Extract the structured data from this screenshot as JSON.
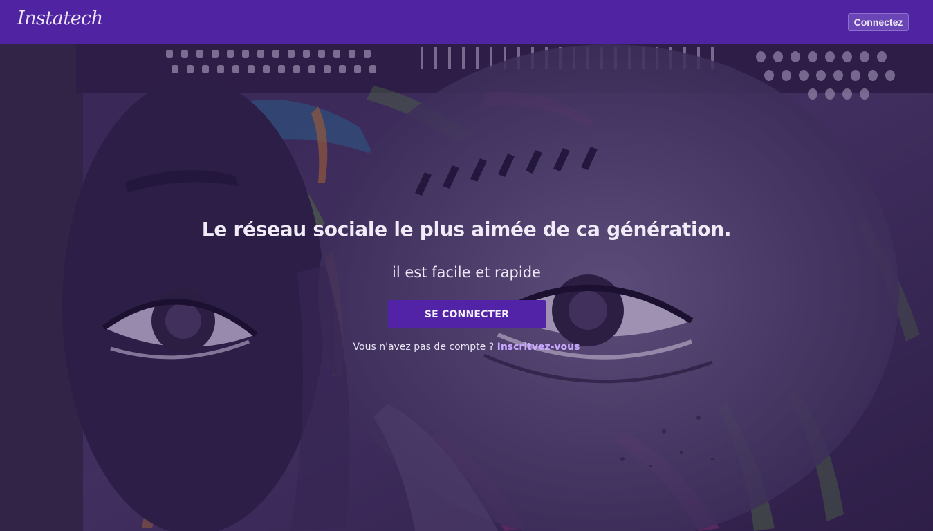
{
  "navbar": {
    "brand": "Instatech",
    "login_button": "Connectez",
    "color": "#4f23a1"
  },
  "hero": {
    "background_image": "graffiti-portrait-mural",
    "headline": "Le réseau sociale le plus aimée de ca génération.",
    "subheadline": "il est facile et rapide",
    "cta_label": "SE CONNECTER",
    "signup_prompt": "Vous n'avez pas de compte ?",
    "signup_link": "Inscritvez-vous",
    "accent_color": "#5223a6",
    "link_color": "#c9a9ff"
  }
}
